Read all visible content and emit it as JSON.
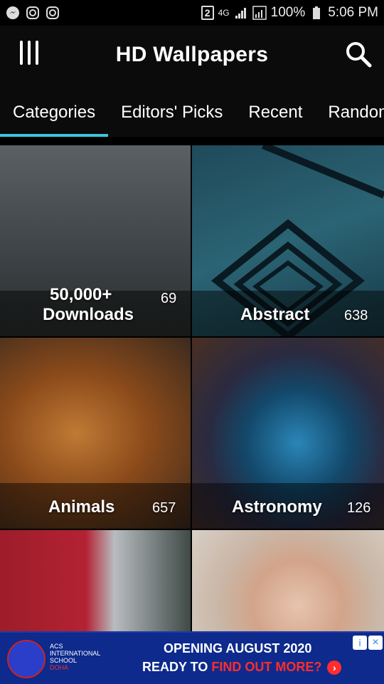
{
  "status_bar": {
    "left_icons": [
      "messenger-icon",
      "instagram-icon",
      "instagram-icon"
    ],
    "sim_badge": "2",
    "network": "4G",
    "battery": "100%",
    "time": "5:06 PM"
  },
  "app_bar": {
    "title": "HD Wallpapers",
    "menu_icon": "menu-icon",
    "search_icon": "search-icon"
  },
  "tabs": [
    {
      "label": "Categories",
      "active": true
    },
    {
      "label": "Editors' Picks",
      "active": false
    },
    {
      "label": "Recent",
      "active": false
    },
    {
      "label": "Random",
      "active": false
    }
  ],
  "colors": {
    "accent": "#3cc5d9",
    "background": "#000000",
    "ad_background": "#0d2a8c",
    "ad_highlight": "#ff2d2d"
  },
  "categories": [
    {
      "name_line1": "50,000+",
      "name_line2": "Downloads",
      "count": "69"
    },
    {
      "name": "Abstract",
      "count": "638"
    },
    {
      "name": "Animals",
      "count": "657"
    },
    {
      "name": "Astronomy",
      "count": "126"
    }
  ],
  "ad": {
    "school_line1": "ACS",
    "school_line2": "INTERNATIONAL",
    "school_line3": "SCHOOL",
    "school_line4": "DOHA",
    "headline": "OPENING AUGUST 2020",
    "sub_prefix": "READY TO ",
    "sub_highlight": "FIND OUT MORE?",
    "info_icon": "info-icon",
    "close_icon": "close-icon"
  }
}
